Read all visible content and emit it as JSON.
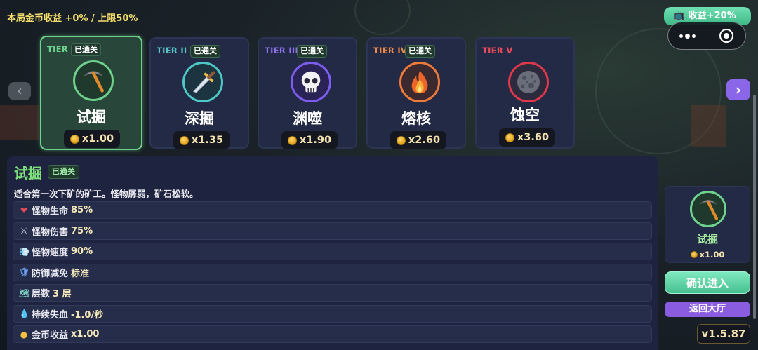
{
  "top": {
    "run_income": "本局金币收益 +0% / 上限50%",
    "income_pill": "📺 收益+20%"
  },
  "tiers": [
    {
      "tier": "TIER I",
      "name": "试掘",
      "badge": "已通关",
      "multiplier": "x1.00",
      "icon": "pickaxe-icon",
      "tier_color": "#6fd28c",
      "ring_color": "#6fd28c",
      "icon_bg": "#1f3a2c",
      "selected": true
    },
    {
      "tier": "TIER II",
      "name": "深掘",
      "badge": "已通关",
      "multiplier": "x1.35",
      "icon": "dagger-icon",
      "tier_color": "#58c6c8",
      "ring_color": "#4ec8c6",
      "icon_bg": "#1c3440",
      "selected": false
    },
    {
      "tier": "TIER III",
      "name": "渊噬",
      "badge": "已通关",
      "multiplier": "x1.90",
      "icon": "skull-icon",
      "tier_color": "#8e72f0",
      "ring_color": "#7d5cf0",
      "icon_bg": "#2a2456",
      "selected": false
    },
    {
      "tier": "TIER IV",
      "name": "熔核",
      "badge": "已通关",
      "multiplier": "x2.60",
      "icon": "fire-icon",
      "tier_color": "#f08a4a",
      "ring_color": "#f07a3a",
      "icon_bg": "#3a2a30",
      "selected": false
    },
    {
      "tier": "TIER V",
      "name": "蚀空",
      "badge": "",
      "multiplier": "x3.60",
      "icon": "moon-rock-icon",
      "tier_color": "#f04a5a",
      "ring_color": "#e0384a",
      "icon_bg": "#2c2a3c",
      "selected": false
    }
  ],
  "detail": {
    "title": "试掘",
    "badge": "已通关",
    "description": "适合第一次下矿的矿工。怪物孱弱，矿石松软。",
    "stats": [
      {
        "icon": "heart-icon",
        "glyph": "❤",
        "color": "#e84a5a",
        "label": "怪物生命",
        "value": "85%"
      },
      {
        "icon": "crossed-swords-icon",
        "glyph": "⚔",
        "color": "#c8ccd8",
        "label": "怪物伤害",
        "value": "75%"
      },
      {
        "icon": "wind-icon",
        "glyph": "💨",
        "color": "#a8d0f0",
        "label": "怪物速度",
        "value": "90%"
      },
      {
        "icon": "shield-icon",
        "glyph": "🛡",
        "color": "#6aa0f0",
        "label": "防御减免",
        "value": "标准"
      },
      {
        "icon": "map-icon",
        "glyph": "🗺",
        "color": "#7ad0c0",
        "label": "层数",
        "value": "3 层"
      },
      {
        "icon": "blood-drop-icon",
        "glyph": "💧",
        "color": "#e8404a",
        "label": "持续失血",
        "value": "-1.0/秒"
      },
      {
        "icon": "coin-icon",
        "glyph": "●",
        "color": "#f4c040",
        "label": "金币收益",
        "value": "x1.00"
      }
    ]
  },
  "selected_summary": {
    "name": "试掘",
    "multiplier": "x1.00"
  },
  "buttons": {
    "enter": "确认进入",
    "back": "返回大厅"
  },
  "version": "v1.5.87",
  "nav": {
    "left": "‹",
    "right": "›"
  }
}
